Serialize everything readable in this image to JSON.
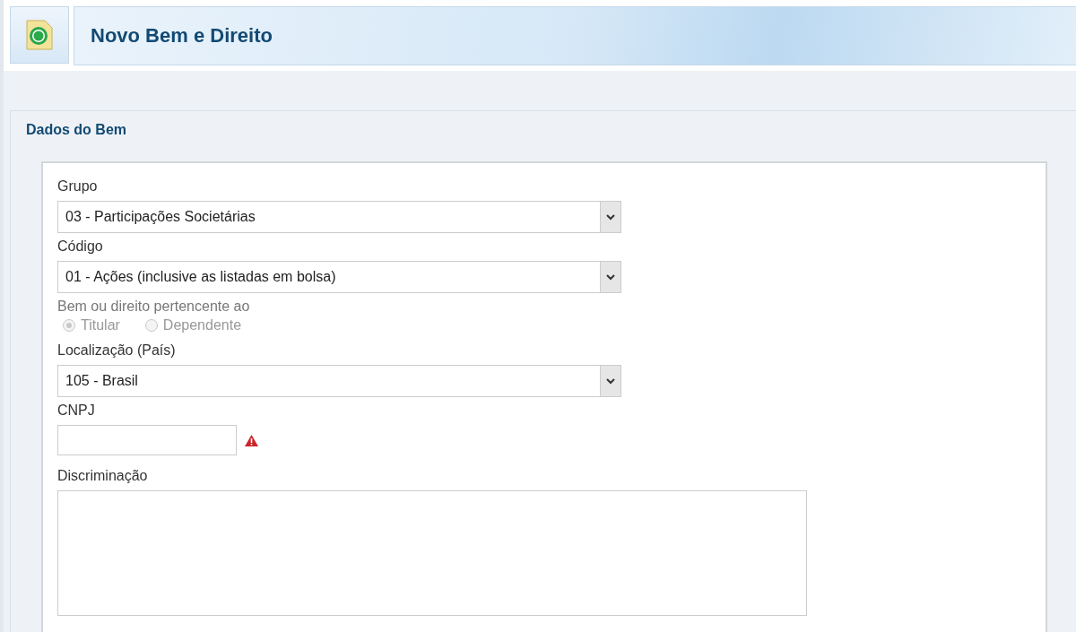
{
  "header": {
    "title": "Novo Bem e Direito"
  },
  "section": {
    "title": "Dados do Bem"
  },
  "fields": [
    {
      "kind": "select",
      "label": "Grupo",
      "value": "03 - Participações Societárias"
    },
    {
      "kind": "select",
      "label": "Código",
      "value": "01 - Ações (inclusive as listadas em bolsa)"
    },
    {
      "kind": "radio",
      "label": "Bem ou direito pertencente ao",
      "disabled": true,
      "options": [
        {
          "label": "Titular",
          "selected": true
        },
        {
          "label": "Dependente",
          "selected": false
        }
      ]
    },
    {
      "kind": "select",
      "label": "Localização (País)",
      "value": "105 - Brasil"
    },
    {
      "kind": "text",
      "label": "CNPJ",
      "warning": true
    },
    {
      "kind": "textarea",
      "label": "Discriminação"
    }
  ]
}
